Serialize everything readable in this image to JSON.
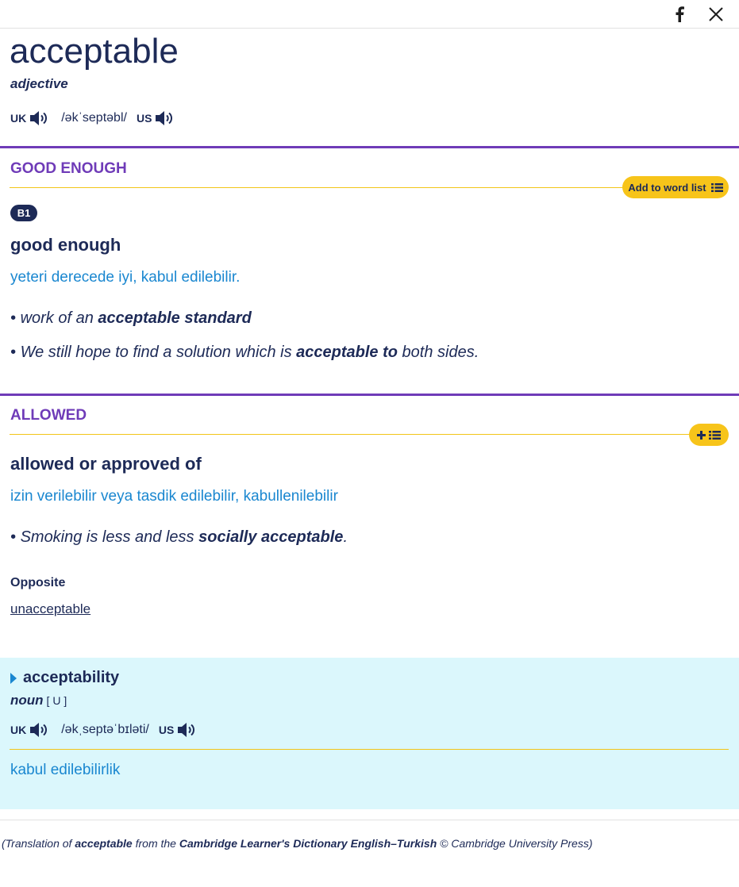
{
  "social": {
    "facebook_icon": "facebook-icon",
    "x_icon": "x-icon"
  },
  "entry": {
    "headword": "acceptable",
    "pos": "adjective",
    "pron": {
      "uk_label": "UK",
      "ipa": "/əkˈseptəbl/",
      "us_label": "US"
    }
  },
  "senses": [
    {
      "title": "GOOD ENOUGH",
      "wordlist_label": "Add to word list",
      "level": "B1",
      "definition": "good enough",
      "translation": "yeteri derecede iyi, kabul edilebilir.",
      "examples": [
        {
          "pre": "work of an ",
          "bold": "acceptable standard",
          "post": ""
        },
        {
          "pre": "We still hope to find a solution which is ",
          "bold": "acceptable to",
          "post": " both sides."
        }
      ]
    },
    {
      "title": "ALLOWED",
      "wordlist_label": "",
      "definition": "allowed or approved of",
      "translation": "izin verilebilir veya tasdik edilebilir, kabullenilebilir",
      "examples": [
        {
          "pre": "Smoking is less and less ",
          "bold": "socially acceptable",
          "post": "."
        }
      ],
      "opposite_label": "Opposite",
      "opposite_word": "unacceptable"
    }
  ],
  "runon": {
    "word": "acceptability",
    "pos": "noun",
    "grammar": "[ U ]",
    "pron": {
      "uk_label": "UK",
      "ipa": "/əkˌseptəˈbɪləti/",
      "us_label": "US"
    },
    "translation": "kabul edilebilirlik"
  },
  "credit": {
    "p1": "(Translation of ",
    "word": "acceptable",
    "p2": " from the ",
    "dict": "Cambridge Learner's Dictionary English–Turkish",
    "p3": " © Cambridge University Press)"
  },
  "colors": {
    "purple": "#6f3bb8",
    "navy": "#1d2a57",
    "link_blue": "#1a87d0",
    "yellow": "#f7c41a",
    "runon_bg": "#dbf7fc"
  }
}
